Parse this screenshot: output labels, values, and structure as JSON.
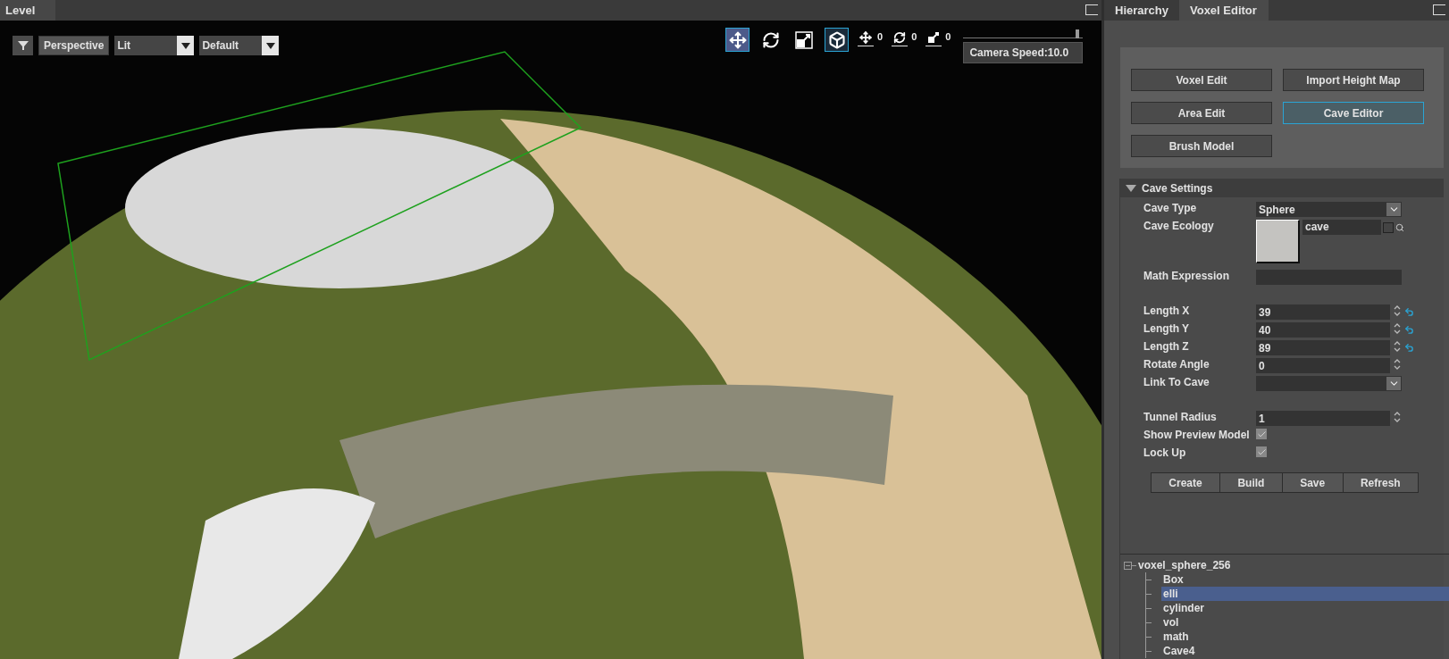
{
  "level_tab": {
    "title": "Level"
  },
  "viewport": {
    "projection": "Perspective",
    "shading": {
      "value": "Lit"
    },
    "layer": {
      "value": "Default"
    },
    "tools": [
      {
        "kind": "move",
        "selected": true
      },
      {
        "kind": "rotate",
        "selected": false
      },
      {
        "kind": "scale",
        "selected": false
      },
      {
        "kind": "local",
        "selected": true
      }
    ],
    "snaps": [
      {
        "kind": "move",
        "value": "0"
      },
      {
        "kind": "rotate",
        "value": "0"
      },
      {
        "kind": "scale",
        "value": "0"
      }
    ],
    "camera_speed": {
      "level": 0.97,
      "tooltip": "Camera Speed:10.0"
    }
  },
  "right_tabs": [
    {
      "label": "Hierarchy",
      "selected": false
    },
    {
      "label": "Voxel Editor",
      "selected": true
    }
  ],
  "mode_buttons": [
    {
      "label": "Voxel Edit",
      "selected": false
    },
    {
      "label": "Import Height Map",
      "selected": false
    },
    {
      "label": "Area Edit",
      "selected": false
    },
    {
      "label": "Cave Editor",
      "selected": true
    },
    {
      "label": "Brush Model",
      "selected": false
    }
  ],
  "cave_settings": {
    "title": "Cave Settings",
    "expanded": true,
    "groups": [
      [
        {
          "kind": "dropdown",
          "label": "Cave Type",
          "value": "Sphere"
        },
        {
          "kind": "asset",
          "label": "Cave Ecology",
          "value": "cave"
        },
        {
          "kind": "text",
          "label": "Math Expression"
        }
      ],
      [
        {
          "kind": "number",
          "label": "Length X",
          "value": "39",
          "reset": true
        },
        {
          "kind": "number",
          "label": "Length Y",
          "value": "40",
          "reset": true
        },
        {
          "kind": "number",
          "label": "Length Z",
          "value": "89",
          "reset": true
        },
        {
          "kind": "number",
          "label": "Rotate Angle",
          "value": "0",
          "reset": false
        },
        {
          "kind": "dropdown",
          "label": "Link To Cave"
        }
      ],
      [
        {
          "kind": "number",
          "label": "Tunnel Radius",
          "value": "1",
          "reset": false
        },
        {
          "kind": "checkbox",
          "label": "Show Preview Model",
          "checked": true
        },
        {
          "kind": "checkbox",
          "label": "Lock Up",
          "checked": true
        }
      ]
    ]
  },
  "actions": [
    "Create",
    "Build",
    "Save",
    "Refresh"
  ],
  "tree": {
    "label": "voxel_sphere_256",
    "expanded": true,
    "children": [
      {
        "label": "Box",
        "selected": false
      },
      {
        "label": "elli",
        "selected": true
      },
      {
        "label": "cylinder",
        "selected": false
      },
      {
        "label": "vol",
        "selected": false
      },
      {
        "label": "math",
        "selected": false
      },
      {
        "label": "Cave4",
        "selected": false
      }
    ]
  }
}
